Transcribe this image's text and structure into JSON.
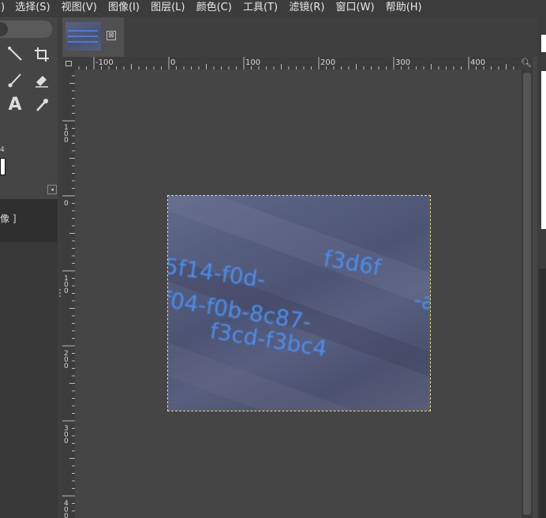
{
  "menubar": {
    "items": [
      ")",
      "选择(S)",
      "视图(V)",
      "图像(I)",
      "图层(L)",
      "颜色(C)",
      "工具(T)",
      "滤镜(R)",
      "窗口(W)",
      "帮助(H)"
    ]
  },
  "toolbox": {
    "tools": [
      {
        "name": "fuzzy-select-icon",
        "glyph": "⁄"
      },
      {
        "name": "crop-icon",
        "glyph": "⌐"
      },
      {
        "name": "paintbrush-icon",
        "glyph": "⁄"
      },
      {
        "name": "eraser-icon",
        "glyph": "◆"
      },
      {
        "name": "text-tool-icon",
        "glyph": "A"
      },
      {
        "name": "color-picker-icon",
        "glyph": "⁄"
      }
    ],
    "fg_label": "4",
    "image_list_label": "像 ]"
  },
  "image_tab": {
    "close_glyph": "⊠"
  },
  "rulers": {
    "horizontal_labels": [
      "-100",
      "0",
      "100",
      "200",
      "300",
      "400"
    ],
    "vertical_labels": [
      "0",
      "100",
      "200",
      "300",
      "400"
    ]
  },
  "image": {
    "text_lines": [
      "5f14-f0d-",
      "f3d6f",
      "f04-f0b-8c87-",
      "-a",
      "f3cd-f3bc4"
    ],
    "text_color": "#4a8ef0"
  },
  "colors": {
    "accent": "#4a8ef0",
    "selection_border": "#e4e46a",
    "background": "#454545"
  }
}
